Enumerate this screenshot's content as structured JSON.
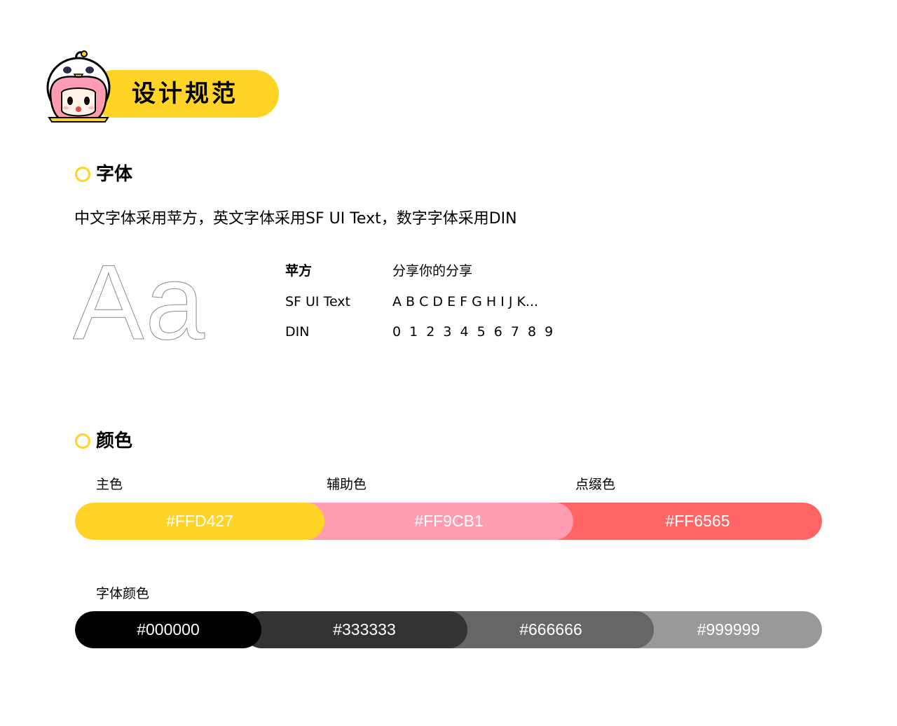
{
  "header": {
    "title": "设计规范"
  },
  "font_section": {
    "title": "字体",
    "description": "中文字体采用苹方，英文字体采用SF UI Text，数字字体采用DIN",
    "sample_glyph": "Aa",
    "specs": [
      {
        "label": "苹方",
        "sample": "分享你的分享"
      },
      {
        "label": "SF UI Text",
        "sample": "A B C D E F G H I J K..."
      },
      {
        "label": "DIN",
        "sample": "0 1 2 3 4 5 6 7 8 9"
      }
    ]
  },
  "color_section": {
    "title": "颜色",
    "groups": [
      {
        "label": "主色",
        "hex": "#FFD427"
      },
      {
        "label": "辅助色",
        "hex": "#FF9CB1"
      },
      {
        "label": "点缀色",
        "hex": "#FF6565"
      }
    ],
    "font_colors_label": "字体颜色",
    "font_colors": [
      {
        "hex": "#000000"
      },
      {
        "hex": "#333333"
      },
      {
        "hex": "#666666"
      },
      {
        "hex": "#999999"
      }
    ]
  },
  "colors": {
    "accent": "#FFD427",
    "pink": "#FF9CB1",
    "red": "#FF6565"
  }
}
